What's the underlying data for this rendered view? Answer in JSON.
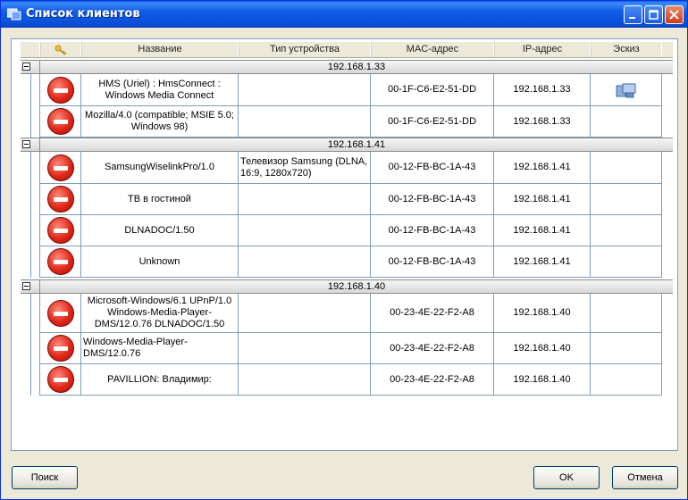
{
  "window": {
    "title": "Список клиентов"
  },
  "columns": [
    "Название",
    "Тип устройства",
    "MAC-адрес",
    "IP-адрес",
    "Эскиз"
  ],
  "groups": [
    {
      "label": "192.168.1.33",
      "rows": [
        {
          "name": "HMS (Uriel) : HmsConnect : Windows Media Connect",
          "type": "",
          "mac": "00-1F-C6-E2-51-DD",
          "ip": "192.168.1.33",
          "thumb": "device-icon"
        },
        {
          "name": "Mozilla/4.0 (compatible; MSIE 5.0; Windows 98)",
          "type": "",
          "mac": "00-1F-C6-E2-51-DD",
          "ip": "192.168.1.33",
          "thumb": ""
        }
      ]
    },
    {
      "label": "192.168.1.41",
      "rows": [
        {
          "name": "SamsungWiselinkPro/1.0",
          "type": "Телевизор Samsung (DLNA, 16:9, 1280x720)",
          "mac": "00-12-FB-BC-1A-43",
          "ip": "192.168.1.41",
          "thumb": ""
        },
        {
          "name": "ТВ в гостиной",
          "type": "",
          "mac": "00-12-FB-BC-1A-43",
          "ip": "192.168.1.41",
          "thumb": ""
        },
        {
          "name": "DLNADOC/1.50",
          "type": "",
          "mac": "00-12-FB-BC-1A-43",
          "ip": "192.168.1.41",
          "thumb": ""
        },
        {
          "name": "Unknown",
          "type": "",
          "mac": "00-12-FB-BC-1A-43",
          "ip": "192.168.1.41",
          "thumb": ""
        }
      ]
    },
    {
      "label": "192.168.1.40",
      "rows": [
        {
          "name": "Microsoft-Windows/6.1 UPnP/1.0 Windows-Media-Player-DMS/12.0.76 DLNADOC/1.50",
          "type": "",
          "mac": "00-23-4E-22-F2-A8",
          "ip": "192.168.1.40",
          "thumb": ""
        },
        {
          "name": "Windows-Media-Player-DMS/12.0.76",
          "type": "",
          "mac": "00-23-4E-22-F2-A8",
          "ip": "192.168.1.40",
          "thumb": ""
        },
        {
          "name": "PAVILLION: Владимир:",
          "type": "",
          "mac": "00-23-4E-22-F2-A8",
          "ip": "192.168.1.40",
          "thumb": ""
        }
      ]
    }
  ],
  "buttons": {
    "search": "Поиск",
    "ok": "OK",
    "cancel": "Отмена"
  }
}
